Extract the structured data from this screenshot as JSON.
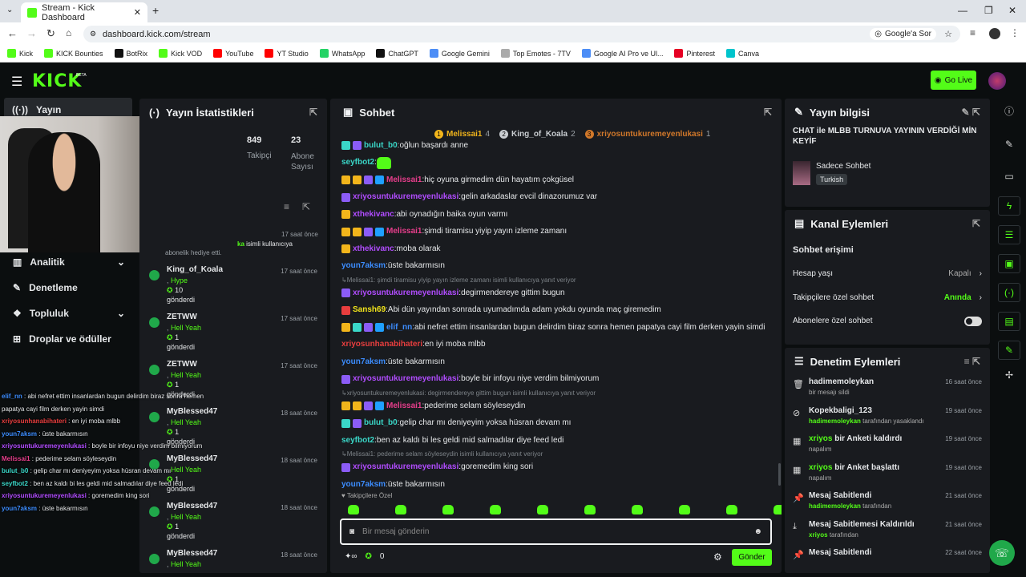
{
  "browser": {
    "tab_title": "Stream - Kick Dashboard",
    "url": "dashboard.kick.com/stream",
    "ask_google": "Google'a Sor",
    "bookmarks": [
      "Kick",
      "KICK Bounties",
      "BotRix",
      "Kick VOD",
      "YouTube",
      "YT Studio",
      "WhatsApp",
      "ChatGPT",
      "Google Gemini",
      "Top Emotes - 7TV",
      "Google AI Pro ve Ul...",
      "Pinterest",
      "Canva"
    ],
    "bookmark_colors": [
      "#53fc18",
      "#53fc18",
      "#111",
      "#53fc18",
      "#ff0000",
      "#ff0000",
      "#25d366",
      "#111",
      "#4c8df6",
      "#aaa",
      "#4c8df6",
      "#e60023",
      "#00c4cc"
    ]
  },
  "header": {
    "logo": "KICK",
    "beta": "BETA",
    "go_live": "Go Live"
  },
  "nav": {
    "active": "Yayın",
    "items": [
      "Analitik",
      "Denetleme",
      "Topluluk",
      "Droplar ve ödüller"
    ]
  },
  "stats": {
    "title": "Yayın İstatistikleri",
    "followers_value": "849",
    "followers_label": "Takipçi",
    "subs_value": "23",
    "subs_label": "Abone Sayısı"
  },
  "events": {
    "first_time": "17 saat önce",
    "first_tail": "ka isimli kullanıcıya",
    "first_line2": "abonelik hediye etti.",
    "items": [
      {
        "user": "King_of_Koala",
        "tag": "Hype",
        "count": "10",
        "sent": "gönderdi",
        "time": "17 saat önce"
      },
      {
        "user": "ZETWW",
        "tag": "Hell Yeah",
        "count": "1",
        "sent": "gönderdi",
        "time": "17 saat önce"
      },
      {
        "user": "ZETWW",
        "tag": "Hell Yeah",
        "count": "1",
        "sent": "gönderdi",
        "time": "17 saat önce"
      },
      {
        "user": "MyBlessed47",
        "tag": "Hell Yeah",
        "count": "1",
        "sent": "gönderdi",
        "time": "18 saat önce"
      },
      {
        "user": "MyBlessed47",
        "tag": "Hell Yeah",
        "count": "1",
        "sent": "gönderdi",
        "time": "18 saat önce"
      },
      {
        "user": "MyBlessed47",
        "tag": "Hell Yeah",
        "count": "1",
        "sent": "gönderdi",
        "time": "18 saat önce"
      },
      {
        "user": "MyBlessed47",
        "tag": "Hell Yeah",
        "count": "",
        "sent": "",
        "time": "18 saat önce"
      }
    ]
  },
  "chat": {
    "title": "Sohbet",
    "top": [
      {
        "rank": "1",
        "name": "Melissai1",
        "count": "4",
        "color": "#f2b51b"
      },
      {
        "rank": "2",
        "name": "King_of_Koala",
        "count": "2",
        "color": "#c9cdd1"
      },
      {
        "rank": "3",
        "name": "xriyosuntukuremeyenlukasi",
        "count": "1",
        "color": "#d1782a"
      }
    ],
    "messages": [
      {
        "type": "msg",
        "user": "bulut_b0",
        "text": "oğlun başardı anne",
        "color": "#3ad7c8",
        "badges": [
          "#3ad7c8",
          "#8b5cf6"
        ]
      },
      {
        "type": "msg",
        "user": "seyfbot2",
        "text": "",
        "color": "#3ad7c8",
        "badges": [],
        "emote": true
      },
      {
        "type": "msg",
        "user": "Melissai1",
        "text": "hiç oyuna girmedim dün hayatım çokgüsel",
        "color": "#e83e8c",
        "badges": [
          "#f2b51b",
          "#f2b51b",
          "#8b5cf6",
          "#1fa0ff"
        ]
      },
      {
        "type": "msg",
        "user": "xriyosuntukuremeyenlukasi",
        "text": "gelin arkadaslar evcil dinazorumuz var",
        "color": "#b14cff",
        "badges": [
          "#8b5cf6"
        ]
      },
      {
        "type": "msg",
        "user": "xthekivanc",
        "text": "abi oynadığın baika oyun varmı",
        "color": "#b14cff",
        "badges": [
          "#f2b51b"
        ]
      },
      {
        "type": "msg",
        "user": "Melissai1",
        "text": "şimdi tiramisu yiyip yayın izleme zamanı",
        "color": "#e83e8c",
        "badges": [
          "#f2b51b",
          "#f2b51b",
          "#8b5cf6",
          "#1fa0ff"
        ]
      },
      {
        "type": "msg",
        "user": "xthekivanc",
        "text": "moba olarak",
        "color": "#b14cff",
        "badges": [
          "#f2b51b"
        ]
      },
      {
        "type": "msg",
        "user": "youn7aksm",
        "text": "üste bakarmısın",
        "color": "#3c8dff",
        "badges": []
      },
      {
        "type": "reply",
        "text": "Melissai1: şimdi tiramisu yiyip yayın izleme zamanı isimli kullanıcıya yanıt veriyor"
      },
      {
        "type": "msg",
        "user": "xriyosuntukuremeyenlukasi",
        "text": "degirmendereye gittim bugun",
        "color": "#b14cff",
        "badges": [
          "#8b5cf6"
        ]
      },
      {
        "type": "msg",
        "user": "Sansh69",
        "text": "Abi dün yayından sonrada uyumadımda adam yokdu oyunda maç giremedim",
        "color": "#f2e51b",
        "badges": [
          "#e83e3e"
        ]
      },
      {
        "type": "msg",
        "user": "elif_nn",
        "text": "abi nefret ettim insanlardan bugun delirdim biraz sonra hemen papatya cayi film derken yayin simdi",
        "color": "#3c8dff",
        "badges": [
          "#f2b51b",
          "#3ad7c8",
          "#8b5cf6",
          "#1fa0ff"
        ]
      },
      {
        "type": "msg",
        "user": "xriyosunhanabihateri",
        "text": "en iyi moba mlbb",
        "color": "#e83e3e",
        "badges": []
      },
      {
        "type": "msg",
        "user": "youn7aksm",
        "text": "üste bakarmısın",
        "color": "#3c8dff",
        "badges": []
      },
      {
        "type": "msg",
        "user": "xriyosuntukuremeyenlukasi",
        "text": "boyle bir infoyu niye verdim bilmiyorum",
        "color": "#b14cff",
        "badges": [
          "#8b5cf6"
        ]
      },
      {
        "type": "reply",
        "text": "xriyosuntukuremeyenlukasi: degirmendereye gittim bugun isimli kullanıcıya yanıt veriyor"
      },
      {
        "type": "msg",
        "user": "Melissai1",
        "text": "pederime selam söyleseydin",
        "color": "#e83e8c",
        "badges": [
          "#f2b51b",
          "#f2b51b",
          "#8b5cf6",
          "#1fa0ff"
        ]
      },
      {
        "type": "msg",
        "user": "bulut_b0",
        "text": "gelip char mı deniyeyim yoksa hüsran devam mı",
        "color": "#3ad7c8",
        "badges": [
          "#3ad7c8",
          "#8b5cf6"
        ]
      },
      {
        "type": "msg",
        "user": "seyfbot2",
        "text": "ben az kaldı bi les geldi mid salmadılar diye feed ledi",
        "color": "#3ad7c8",
        "badges": []
      },
      {
        "type": "reply",
        "text": "Melissai1: pederime selam söyleseydin isimli kullanıcıya yanıt veriyor"
      },
      {
        "type": "msg",
        "user": "xriyosuntukuremeyenlukasi",
        "text": "goremedim king sori",
        "color": "#b14cff",
        "badges": [
          "#8b5cf6"
        ]
      },
      {
        "type": "msg",
        "user": "youn7aksm",
        "text": "üste bakarmısın",
        "color": "#3c8dff",
        "badges": []
      }
    ],
    "followers_only": "Takipçilere Özel",
    "input_placeholder": "Bir mesaj gönderin",
    "kicks": "0",
    "send": "Gönder"
  },
  "overlay": [
    {
      "user": "elif_nn",
      "text": "abi nefret ettim insanlardan bugun delirdim biraz sonra hemen",
      "color": "#3c8dff"
    },
    {
      "user": "",
      "text": "papatya cayi film derken yayin simdi",
      "color": "#fff"
    },
    {
      "user": "xriyosunhanabihateri",
      "text": "en iyi moba mlbb",
      "color": "#e83e3e"
    },
    {
      "user": "youn7aksm",
      "text": "üste bakarmısın",
      "color": "#3c8dff"
    },
    {
      "user": "xriyosuntukuremeyenlukasi",
      "text": "boyle bir infoyu niye verdim bilmiyorum",
      "color": "#b14cff"
    },
    {
      "user": "Melissai1",
      "text": "pederime selam söyleseydin",
      "color": "#e83e8c"
    },
    {
      "user": "bulut_b0",
      "text": "gelip char mı deniyeyim yoksa hüsran devam mı",
      "color": "#3ad7c8"
    },
    {
      "user": "seyfbot2",
      "text": "ben az kaldı bi les geldi mid salmadılar diye feed ledi",
      "color": "#3ad7c8"
    },
    {
      "user": "xriyosuntukuremeyenlukasi",
      "text": "goremedim king sori",
      "color": "#b14cff"
    },
    {
      "user": "youn7aksm",
      "text": "üste bakarmısın",
      "color": "#3c8dff"
    }
  ],
  "info": {
    "title": "Yayın bilgisi",
    "stream_title": "CHAT ile MLBB TURNUVA YAYININ VERDİĞİ MİN KEYİF",
    "category": "Sadece Sohbet",
    "language": "Turkish"
  },
  "actions": {
    "title": "Kanal Eylemleri",
    "chat_access": "Sohbet erişimi",
    "rows": [
      {
        "label": "Hesap yaşı",
        "value": "Kapalı"
      },
      {
        "label": "Takipçilere özel sohbet",
        "value": "Anında"
      },
      {
        "label": "Abonelere özel sohbet",
        "value": ""
      }
    ]
  },
  "mod": {
    "title": "Denetim Eylemleri",
    "items": [
      {
        "icon": "trash-icon",
        "glyph": "🗑",
        "main": "hadimemoleykan",
        "sub_user": "",
        "sub": "bir mesajı sildi",
        "time": "16 saat önce"
      },
      {
        "icon": "ban-icon",
        "glyph": "⊘",
        "main": "Kopekbaligi_123",
        "sub_user": "hadimemoleykan",
        "sub": "tarafından yasaklandı",
        "time": "19 saat önce"
      },
      {
        "icon": "poll-icon",
        "glyph": "▦",
        "main": "xriyos bir Anketi kaldırdı",
        "sub_user": "",
        "sub": "napalım",
        "time": "19 saat önce"
      },
      {
        "icon": "poll-icon",
        "glyph": "▦",
        "main": "xriyos bir Anket başlattı",
        "sub_user": "",
        "sub": "napalım",
        "time": "19 saat önce"
      },
      {
        "icon": "pin-icon",
        "glyph": "📌",
        "main": "Mesaj Sabitlendi",
        "sub_user": "hadimemoleykan",
        "sub": "tarafından",
        "time": "21 saat önce"
      },
      {
        "icon": "unpin-icon",
        "glyph": "⤓",
        "main": "Mesaj Sabitlemesi Kaldırıldı",
        "sub_user": "xriyos",
        "sub": "tarafından",
        "time": "21 saat önce"
      },
      {
        "icon": "pin-icon",
        "glyph": "📌",
        "main": "Mesaj Sabitlendi",
        "sub_user": "",
        "sub": "",
        "time": "22 saat önce"
      }
    ]
  }
}
